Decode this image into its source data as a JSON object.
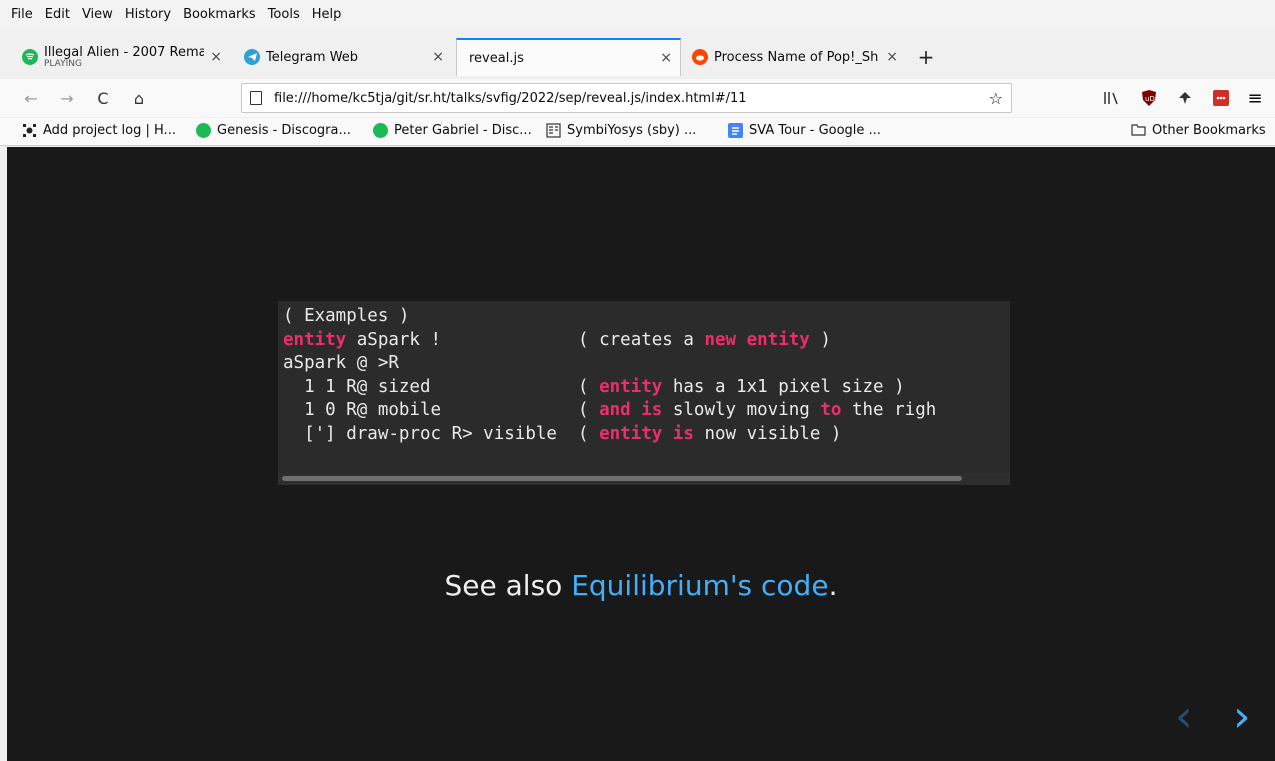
{
  "menu": {
    "file": "File",
    "edit": "Edit",
    "view": "View",
    "history": "History",
    "bookmarks": "Bookmarks",
    "tools": "Tools",
    "help": "Help"
  },
  "tabs": [
    {
      "title": "Illegal Alien - 2007 Rema",
      "sub": "PLAYING",
      "icon": "spotify-icon"
    },
    {
      "title": "Telegram Web",
      "icon": "telegram-icon"
    },
    {
      "title": "reveal.js",
      "icon": "none"
    },
    {
      "title": "Process Name of Pop!_Sh",
      "icon": "reddit-icon"
    }
  ],
  "tab_close": "×",
  "new_tab": "+",
  "nav": {
    "url": "file:///home/kc5tja/git/sr.ht/talks/svfig/2022/sep/reveal.js/index.html#/11",
    "back": "←",
    "forward": "→",
    "reload": "C",
    "home": "⌂",
    "star": "☆",
    "menu": "≡"
  },
  "bookmarks": [
    {
      "label": "Add project log | H...",
      "icon": "hackaday-icon"
    },
    {
      "label": "Genesis - Discogra...",
      "icon": "spotify-icon"
    },
    {
      "label": "Peter Gabriel - Disc...",
      "icon": "spotify-icon"
    },
    {
      "label": "SymbiYosys (sby) ...",
      "icon": "docs-icon"
    },
    {
      "label": "SVA Tour - Google ...",
      "icon": "google-docs-icon"
    }
  ],
  "other_bookmarks": "Other Bookmarks",
  "slide": {
    "code_lines": [
      {
        "line": "( Examples )"
      },
      {
        "kw": "entity",
        "rest": " aSpark !",
        "comment_pre": "( creates a ",
        "comment_kw": "new entity",
        "comment_post": " )"
      },
      {
        "line": "aSpark @ >R"
      },
      {
        "rest": "  1 1 R@ sized",
        "comment_pre": "( ",
        "comment_kw": "entity",
        "comment_post": " has a 1x1 pixel size )"
      },
      {
        "rest": "  1 0 R@ mobile",
        "comment_pre": "( ",
        "comment_kw": "and is",
        "comment_mid": " slowly moving ",
        "comment_kw2": "to",
        "comment_post": " the righ"
      },
      {
        "rest": "  ['] draw-proc R> visible",
        "comment_pre": "( ",
        "comment_kw": "entity is",
        "comment_post": " now visible )"
      }
    ],
    "see_also_prefix": "See also ",
    "see_also_link": "Equilibrium's code",
    "see_also_suffix": ".",
    "prev_arrow": "‹",
    "next_arrow": "›"
  },
  "colors": {
    "keyword": "#ee2d6b",
    "link": "#42affa",
    "slide_bg": "#191919",
    "code_bg": "#2b2b2b"
  }
}
